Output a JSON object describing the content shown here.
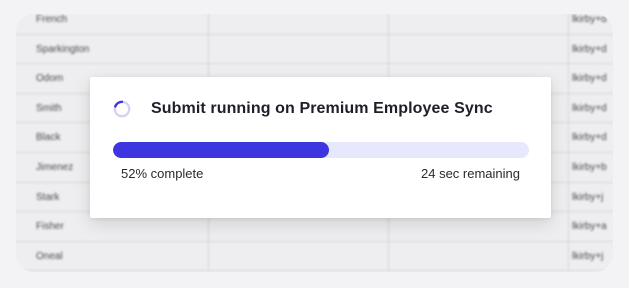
{
  "background_table": {
    "rows": [
      {
        "name": "French",
        "email": "lkirby+d"
      },
      {
        "name": "Sparkington",
        "email": "lkirby+d"
      },
      {
        "name": "Odom",
        "email": "lkirby+d"
      },
      {
        "name": "Smith",
        "email": "lkirby+d"
      },
      {
        "name": "Black",
        "email": "lkirby+d"
      },
      {
        "name": "Jimenez",
        "email": "lkirby+b"
      },
      {
        "name": "Stark",
        "email": "lkirby+j"
      },
      {
        "name": "Fisher",
        "email": "lkirby+a"
      },
      {
        "name": "Oneal",
        "email": "lkirby+j"
      }
    ]
  },
  "progress_dialog": {
    "title": "Submit running on Premium Employee Sync",
    "progress_fraction": 0.52,
    "percent_label": "52% complete",
    "remaining_label": "24 sec remaining",
    "spinner_icon": "loading-spinner-icon",
    "colors": {
      "accent": "#3c35e0",
      "track": "#e6e8fc",
      "spinner_light": "#d4d2f7"
    }
  }
}
